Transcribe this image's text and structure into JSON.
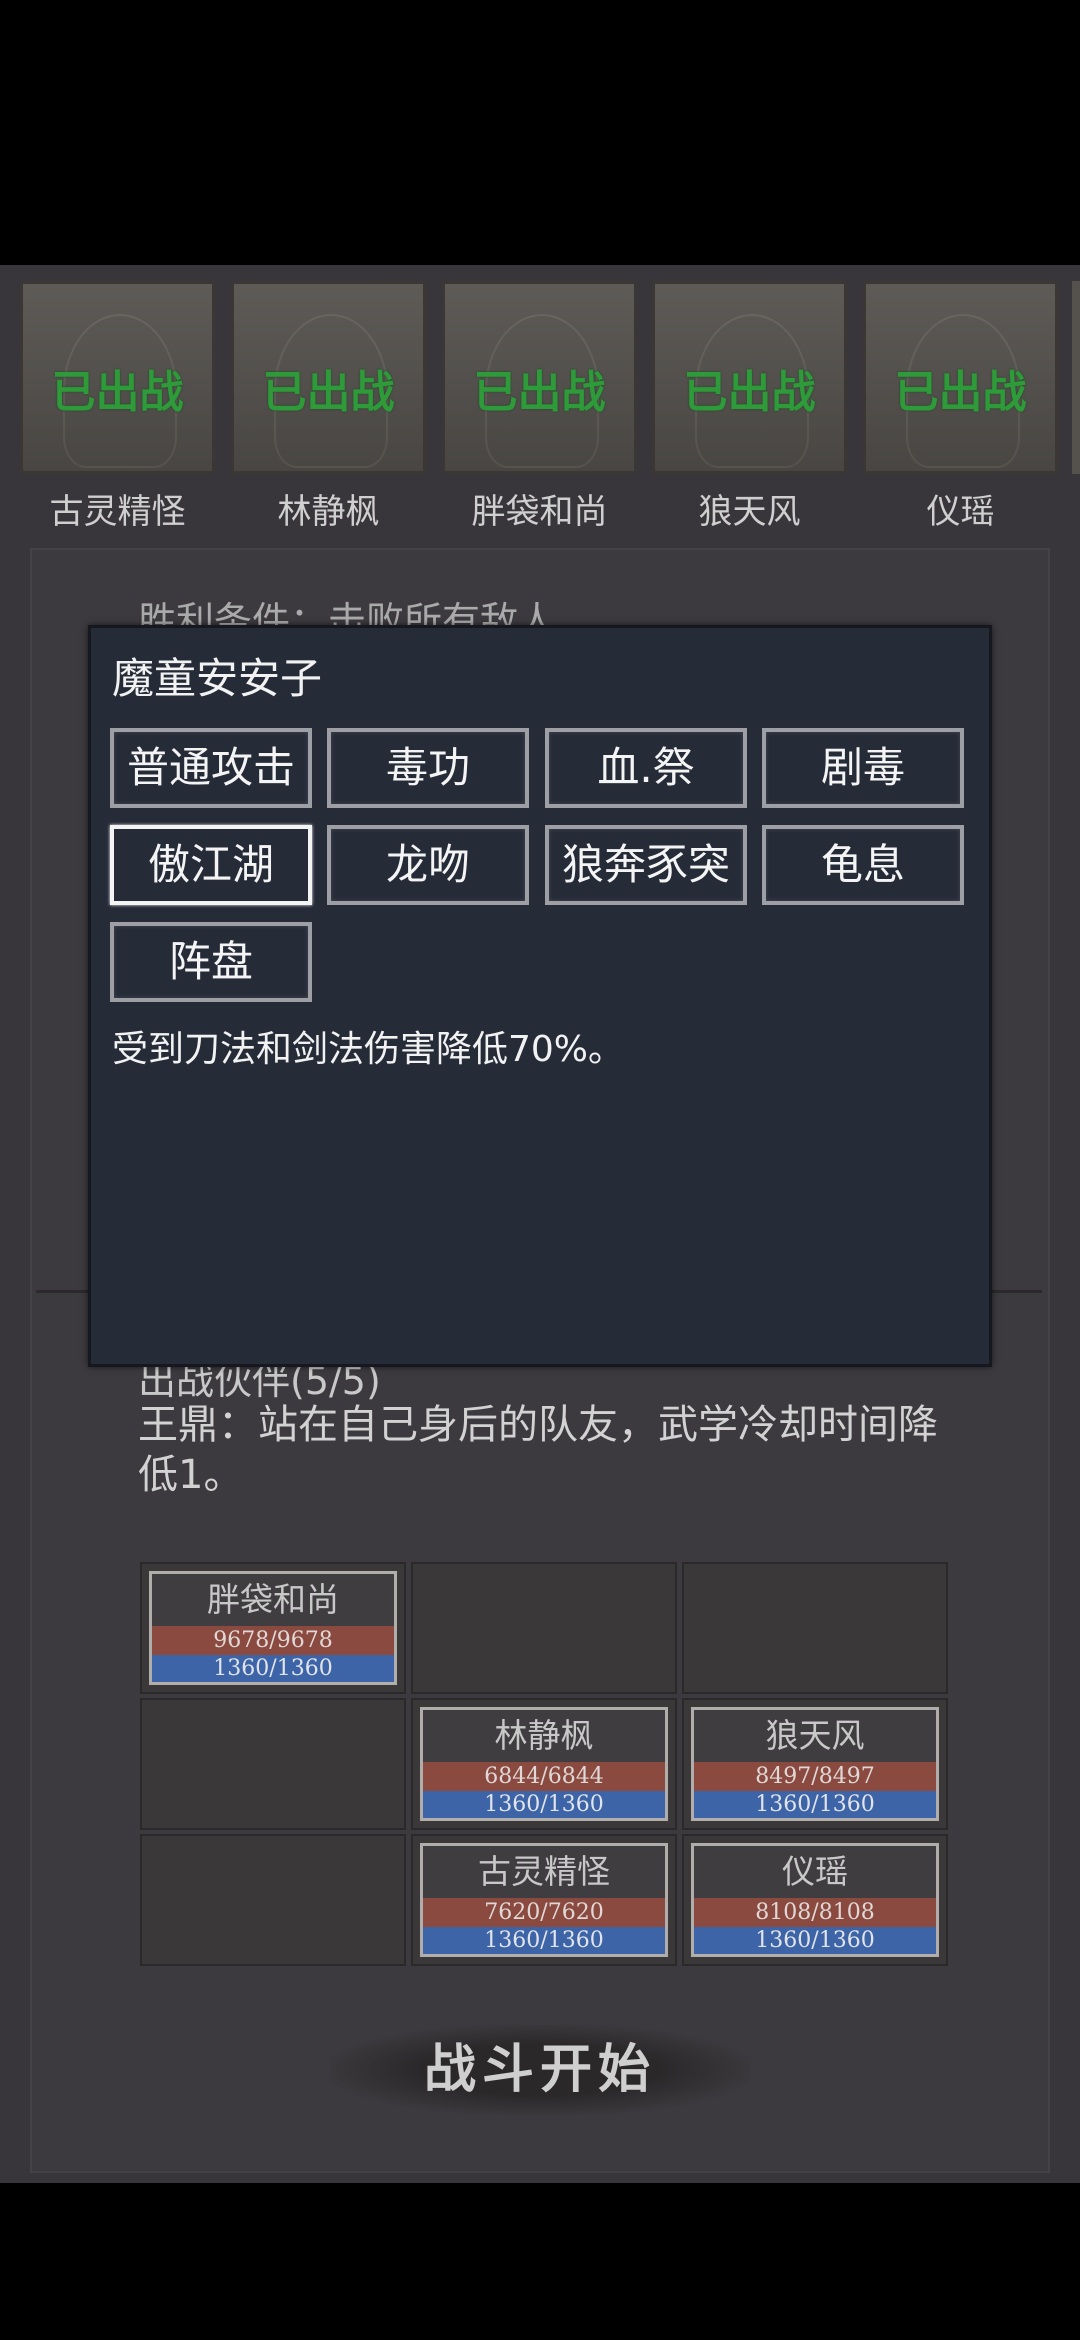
{
  "roster": {
    "heroes": [
      {
        "name": "古灵精怪",
        "status": "已出战"
      },
      {
        "name": "林静枫",
        "status": "已出战"
      },
      {
        "name": "胖袋和尚",
        "status": "已出战"
      },
      {
        "name": "狼天风",
        "status": "已出战"
      },
      {
        "name": "仪瑶",
        "status": "已出战"
      }
    ]
  },
  "panel": {
    "victory": "胜利条件：击败所有敌人",
    "partners_title": "出战伙伴(5/5)",
    "description": "王鼎：站在自己身后的队友，武学冷却时间降低1。"
  },
  "formation": [
    {
      "name": "胖袋和尚",
      "hp": "9678/9678",
      "mp": "1360/1360"
    },
    {
      "name": "林静枫",
      "hp": "6844/6844",
      "mp": "1360/1360"
    },
    {
      "name": "狼天风",
      "hp": "8497/8497",
      "mp": "1360/1360"
    },
    {
      "name": "古灵精怪",
      "hp": "7620/7620",
      "mp": "1360/1360"
    },
    {
      "name": "仪瑶",
      "hp": "8108/8108",
      "mp": "1360/1360"
    }
  ],
  "start_button": "战斗开始",
  "modal": {
    "title": "魔童安安子",
    "skills": [
      "普通攻击",
      "毒功",
      "血.祭",
      "剧毒",
      "傲江湖",
      "龙吻",
      "狼奔豕突",
      "龟息",
      "阵盘"
    ],
    "selected_skill": "傲江湖",
    "skill_description": "受到刀法和剑法伤害降低70%。"
  },
  "colors": {
    "deployed_text": "#2f9a3a",
    "hp_bar": "#8a4a40",
    "mp_bar": "#3e64a8",
    "modal_bg": "#262b38"
  }
}
